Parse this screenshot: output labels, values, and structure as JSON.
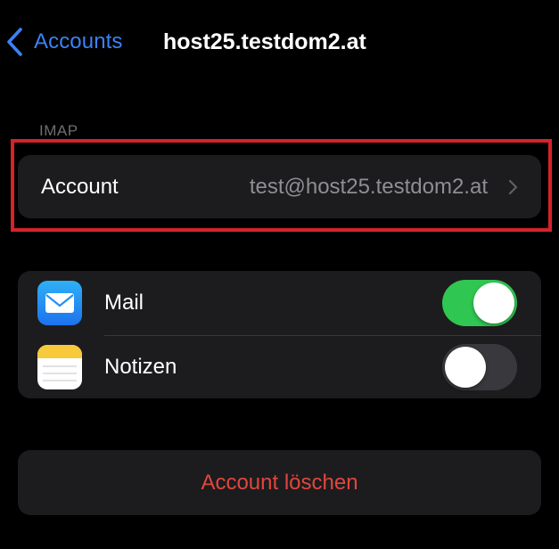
{
  "nav": {
    "back_label": "Accounts",
    "title": "host25.testdom2.at"
  },
  "section": {
    "label": "IMAP"
  },
  "account_row": {
    "label": "Account",
    "value": "test@host25.testdom2.at"
  },
  "services": [
    {
      "label": "Mail",
      "icon": "mail-app-icon",
      "enabled": true
    },
    {
      "label": "Notizen",
      "icon": "notes-app-icon",
      "enabled": false
    }
  ],
  "delete": {
    "label": "Account löschen"
  },
  "colors": {
    "background": "#000000",
    "group_background": "#1c1c1e",
    "accent_blue": "#3a82f7",
    "toggle_on": "#30c652",
    "toggle_off": "#39393d",
    "destructive": "#e2463d",
    "highlight": "#d6222a",
    "secondary_text": "#8e8e93"
  }
}
